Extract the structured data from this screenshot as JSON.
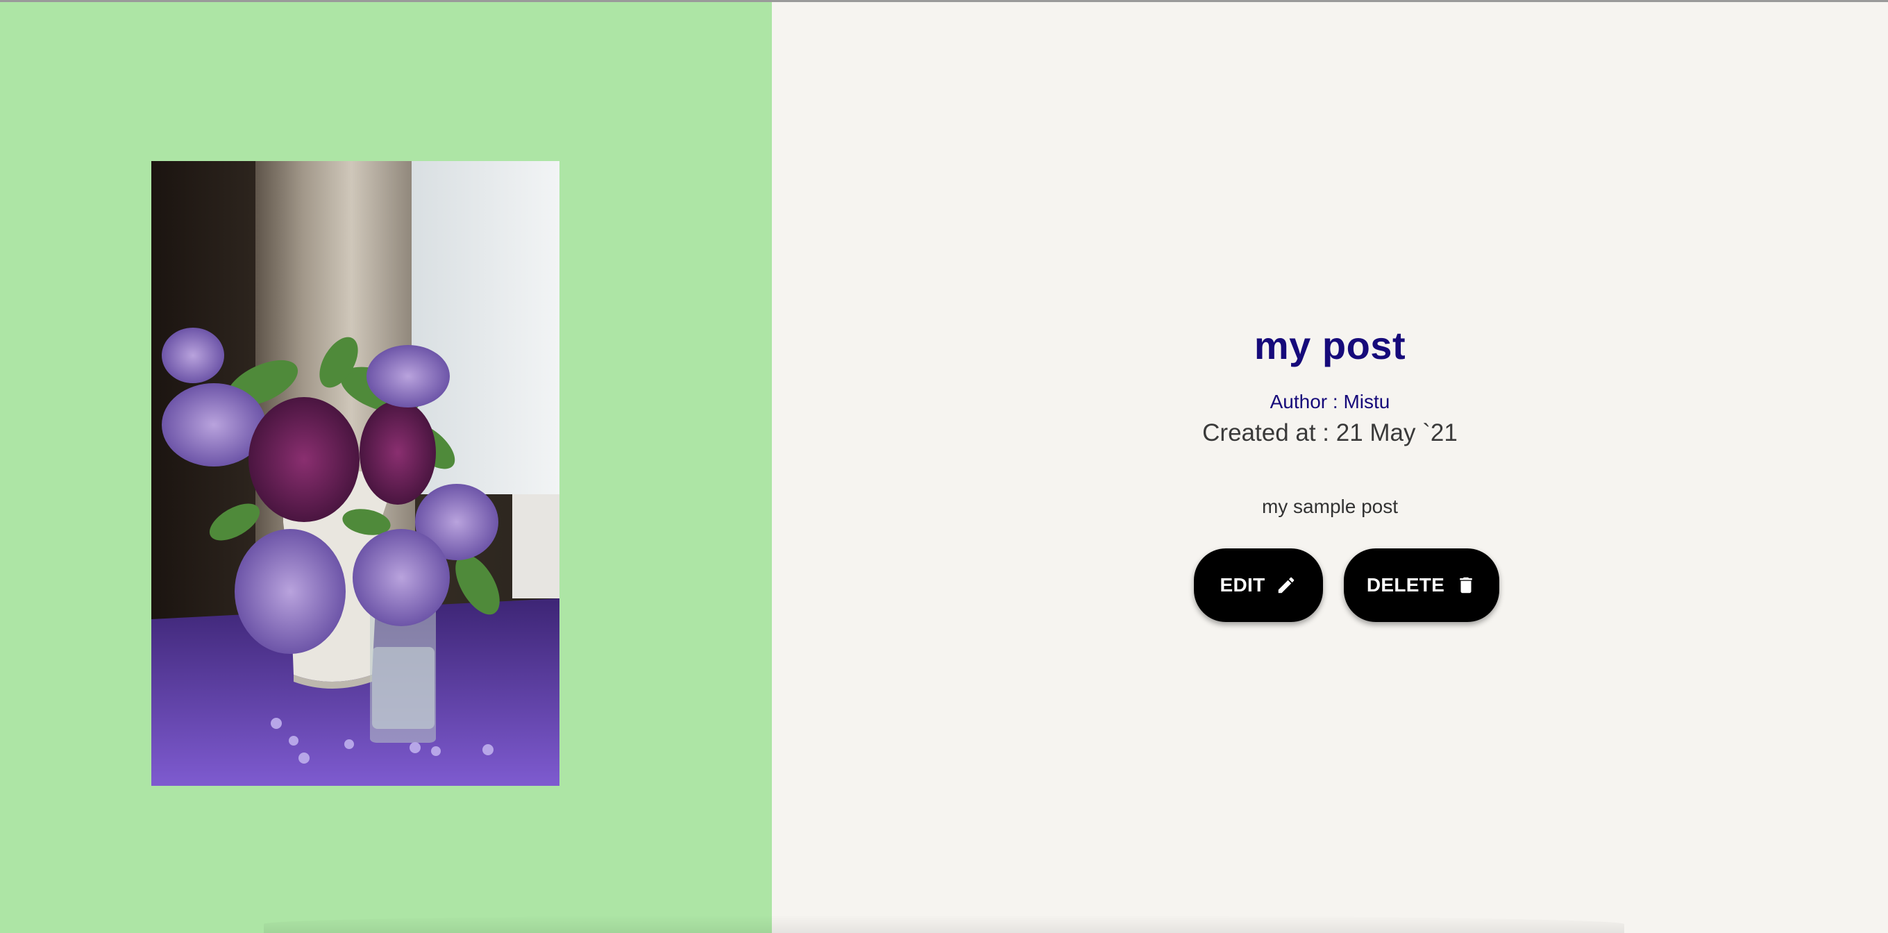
{
  "post": {
    "title": "my post",
    "author": "Author : Mistu",
    "created": "Created at : 21 May `21",
    "body": "my sample post"
  },
  "actions": {
    "edit_label": "EDIT",
    "delete_label": "DELETE",
    "edit_icon": "pencil-icon",
    "delete_icon": "trash-icon"
  },
  "colors": {
    "left_pane_bg": "#ade5a5",
    "right_pane_bg": "#f6f4f0",
    "title_color": "#160a7a",
    "button_bg": "#000000"
  },
  "image": {
    "subject": "lilac-bouquet-photo"
  }
}
